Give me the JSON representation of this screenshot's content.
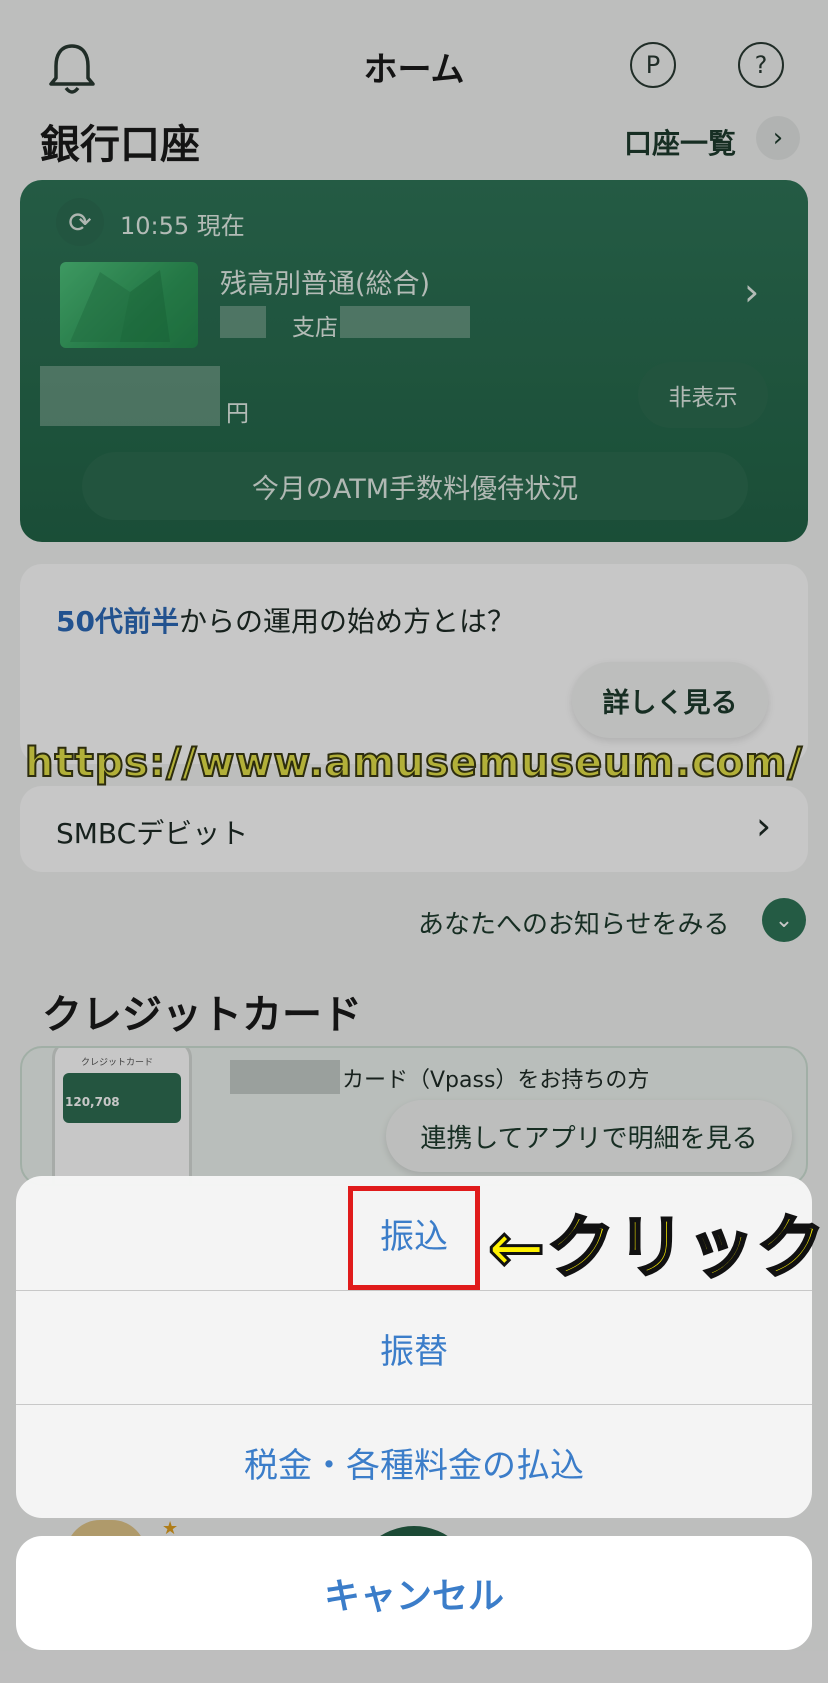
{
  "header": {
    "title": "ホーム",
    "points_label": "P",
    "help_label": "?"
  },
  "bank": {
    "section_title": "銀行口座",
    "account_list_label": "口座一覧",
    "updated_time": "10:55 現在",
    "account_type": "残高別普通(総合)",
    "branch_label": "支店",
    "currency": "円",
    "hide_button": "非表示",
    "atm_button": "今月のATM手数料優待状況"
  },
  "promo": {
    "highlight": "50代前半",
    "text": "からの運用の始め方とは？",
    "button": "詳しく見る"
  },
  "watermark": "https://www.amusemuseum.com/",
  "debit": {
    "label": "SMBCデビット"
  },
  "notice": {
    "label": "あなたへのお知らせをみる"
  },
  "credit": {
    "section_title": "クレジットカード",
    "text": "カード（Vpass）をお持ちの方",
    "button": "連携してアプリで明細を見る",
    "phone_title": "クレジットカード",
    "phone_amount": "120,708"
  },
  "action_sheet": {
    "items": [
      "振込",
      "振替",
      "税金・各種料金の払込"
    ],
    "cancel": "キャンセル"
  },
  "annotation": "←クリック",
  "colors": {
    "brand_green": "#226447",
    "action_blue": "#3b7dc9",
    "highlight_red": "#e01b1b",
    "annotation_yellow": "#fff200"
  }
}
